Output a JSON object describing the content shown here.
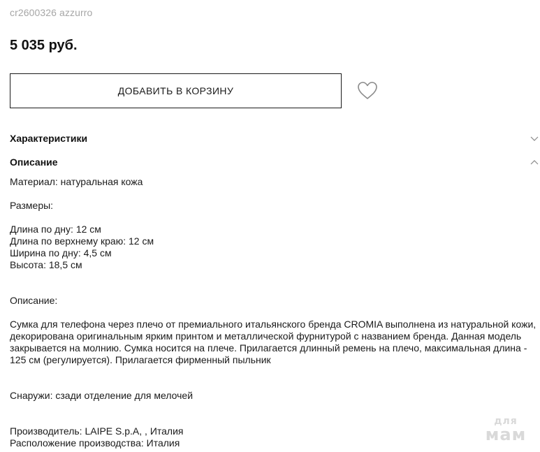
{
  "product": {
    "sku": "cr2600326 azzurro",
    "price": "5 035 руб.",
    "add_to_cart_label": "ДОБАВИТЬ В КОРЗИНУ",
    "wishlist_icon": "heart-icon"
  },
  "sections": {
    "characteristics": {
      "title": "Характеристики",
      "state": "collapsed",
      "icon": "chevron-down-icon"
    },
    "description": {
      "title": "Описание",
      "state": "expanded",
      "icon": "chevron-up-icon"
    }
  },
  "description_content": {
    "material": "Материал: натуральная кожа",
    "sizes_label": "Размеры:",
    "sizes": "Длина по дну: 12 см\nДлина по верхнему краю: 12 см\nШирина по дну: 4,5 см\nВысота: 18,5 см",
    "description_label": "Описание:",
    "description_text": "Сумка для телефона через плечо от премиального итальянского бренда CROMIA выполнена из натуральной кожи, декорирована оригинальным ярким принтом и металлической фурнитурой с названием бренда. Данная модель закрывается на молнию. Сумка носится на плече. Прилагается длинный ремень на плечо, максимальная длина - 125 см (регулируется). Прилагается фирменный пыльник",
    "outside": "Снаружи: сзади отделение для мелочей",
    "manufacturer": "Производитель: LAIPE S.p.A, , Италия\nРасположение производства: Италия"
  },
  "watermark": {
    "line1": "для",
    "line2": "мам"
  }
}
